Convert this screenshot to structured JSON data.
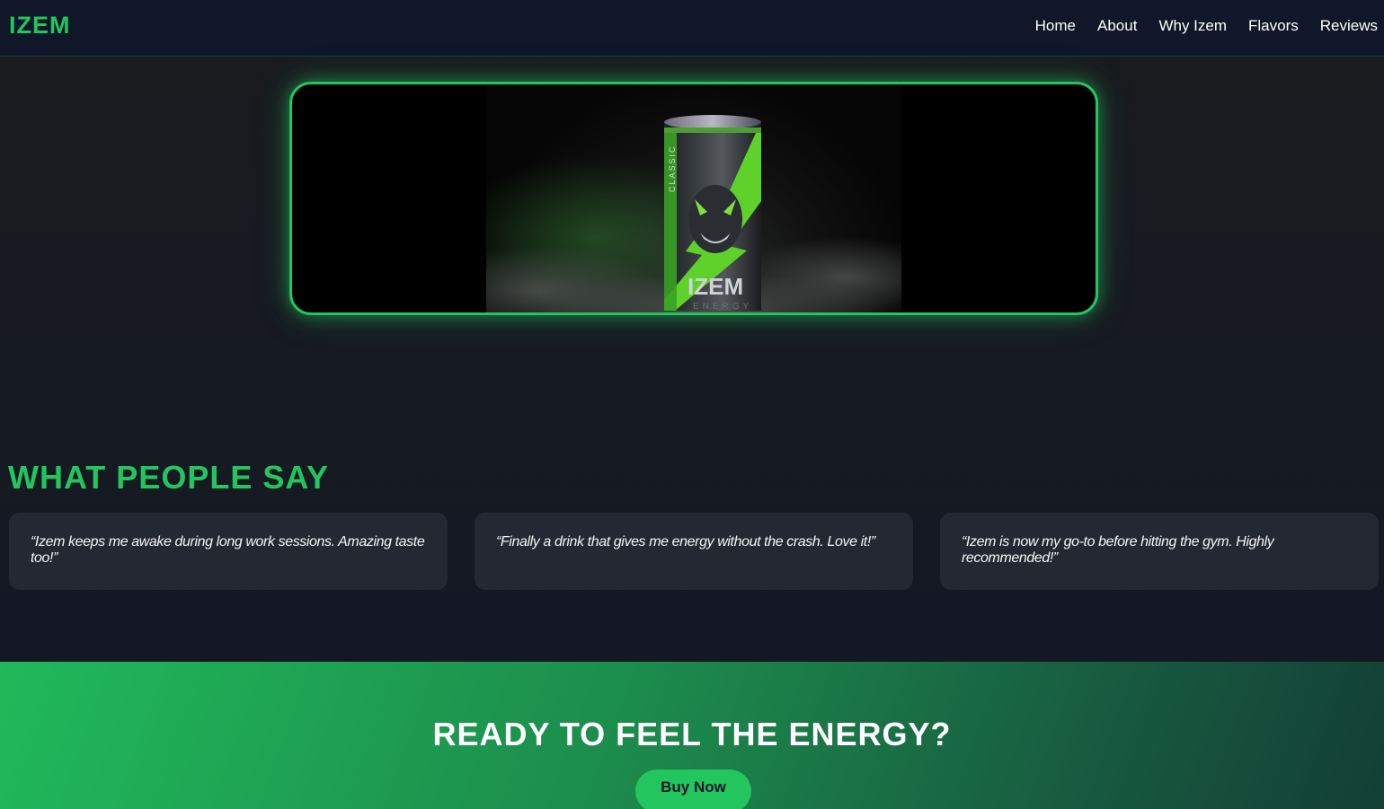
{
  "brand": {
    "logo": "IZEM",
    "accent": "#22c55e"
  },
  "nav": {
    "items": [
      {
        "label": "Home"
      },
      {
        "label": "About"
      },
      {
        "label": "Why Izem"
      },
      {
        "label": "Flavors"
      },
      {
        "label": "Reviews"
      }
    ]
  },
  "video": {
    "can_brand": "IZEM",
    "can_sub": "ENERGY",
    "can_flavor": "CLASSIC"
  },
  "reviews": {
    "title": "WHAT PEOPLE SAY",
    "items": [
      {
        "quote": "“Izem keeps me awake during long work sessions. Amazing taste too!”"
      },
      {
        "quote": "“Finally a drink that gives me energy without the crash. Love it!”"
      },
      {
        "quote": "“Izem is now my go-to before hitting the gym. Highly recommended!”"
      }
    ]
  },
  "cta": {
    "title": "READY TO FEEL THE ENERGY?",
    "button": "Buy Now"
  }
}
